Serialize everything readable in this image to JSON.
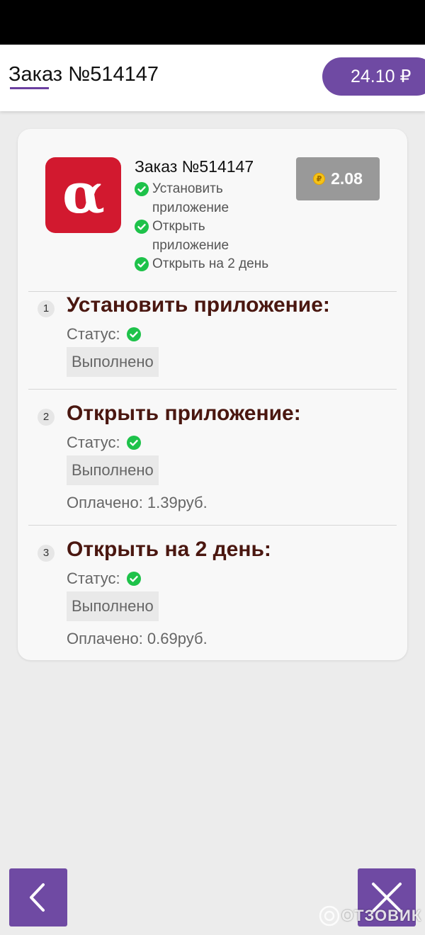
{
  "header": {
    "title": "Заказ №514147",
    "balance": "24.10 ₽"
  },
  "offer": {
    "logo_icon": "alfa-bank-logo",
    "order_name": "Заказ №514147",
    "reward": "2.08",
    "reward_icon": "ruble-coin-icon",
    "summary": [
      {
        "label": "Установить приложение",
        "line1": "Установить",
        "line2": "приложение"
      },
      {
        "label": "Открыть приложение",
        "line1": "Открыть",
        "line2": "приложение"
      },
      {
        "label": "Открыть на 2 день",
        "line1": "Открыть на 2 день",
        "line2": ""
      }
    ]
  },
  "tasks": [
    {
      "number": "1",
      "title": "Установить приложение:",
      "status_label": "Статус:",
      "status_chip": "Выполнено",
      "paid": ""
    },
    {
      "number": "2",
      "title": "Открыть приложение:",
      "status_label": "Статус:",
      "status_chip": "Выполнено",
      "paid": "Оплачено: 1.39руб."
    },
    {
      "number": "3",
      "title": "Открыть на 2 день:",
      "status_label": "Статус:",
      "status_chip": "Выполнено",
      "paid": "Оплачено: 0.69руб."
    }
  ],
  "footer": {
    "back_icon": "chevron-left-icon",
    "close_icon": "close-icon",
    "watermark": "ОТЗОВИК"
  },
  "colors": {
    "accent": "#6f4aa3",
    "check": "#1ec24a",
    "title_brown": "#4a1710",
    "logo_red": "#d2192f"
  }
}
